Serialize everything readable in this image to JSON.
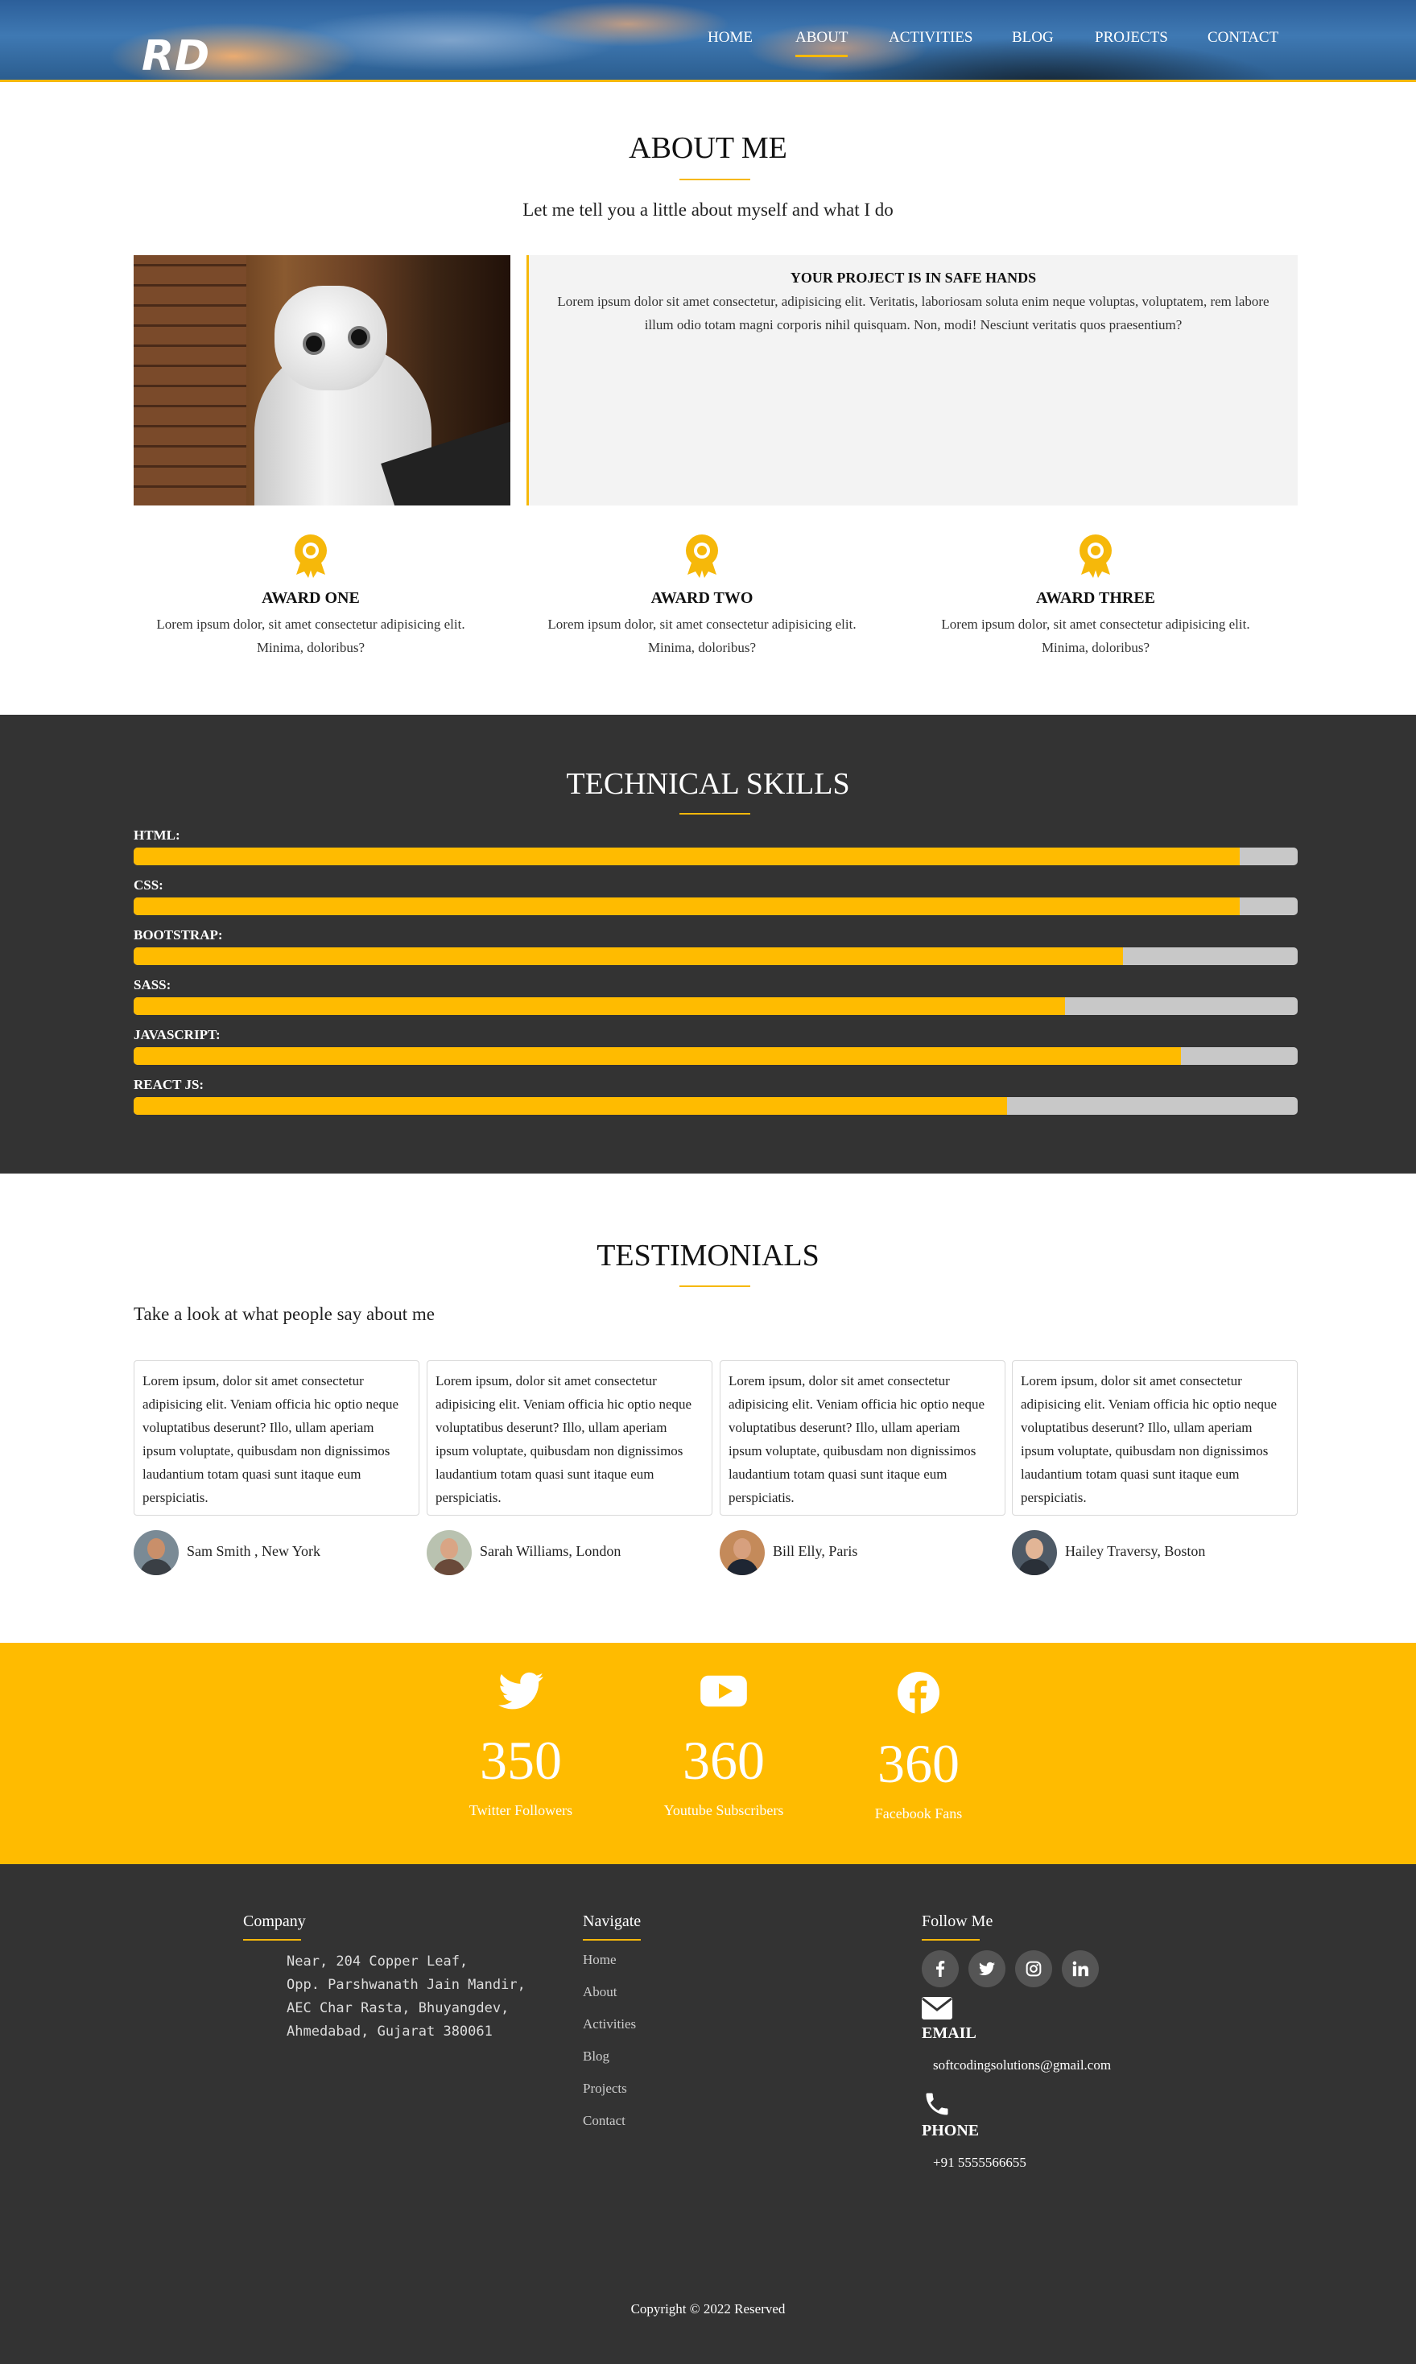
{
  "header": {
    "logo": "RD",
    "nav": [
      {
        "label": "HOME"
      },
      {
        "label": "ABOUT"
      },
      {
        "label": "ACTIVITIES"
      },
      {
        "label": "BLOG"
      },
      {
        "label": "PROJECTS"
      },
      {
        "label": "CONTACT"
      }
    ],
    "active_nav": "ABOUT"
  },
  "about": {
    "title": "ABOUT ME",
    "lead": "Let me tell you a little about myself and what I do",
    "box_title": "YOUR PROJECT IS IN SAFE HANDS",
    "box_text": "Lorem ipsum dolor sit amet consectetur, adipisicing elit. Veritatis, laboriosam soluta enim neque voluptas, voluptatem, rem labore illum odio totam magni corporis nihil quisquam. Non, modi! Nesciunt veritatis quos praesentium?",
    "awards": [
      {
        "title": "AWARD ONE",
        "text": "Lorem ipsum dolor, sit amet consectetur adipisicing elit. Minima, doloribus?"
      },
      {
        "title": "AWARD TWO",
        "text": "Lorem ipsum dolor, sit amet consectetur adipisicing elit. Minima, doloribus?"
      },
      {
        "title": "AWARD THREE",
        "text": "Lorem ipsum dolor, sit amet consectetur adipisicing elit. Minima, doloribus?"
      }
    ]
  },
  "skills": {
    "title": "TECHNICAL SKILLS",
    "items": [
      {
        "label": "HTML:",
        "level": 0.95
      },
      {
        "label": "CSS:",
        "level": 0.95
      },
      {
        "label": "BOOTSTRAP:",
        "level": 0.85
      },
      {
        "label": "SASS:",
        "level": 0.8
      },
      {
        "label": "JAVASCRIPT:",
        "level": 0.9
      },
      {
        "label": "REACT JS:",
        "level": 0.75
      }
    ]
  },
  "testimonials": {
    "title": "TESTIMONIALS",
    "lead": "Take a look at what people say about me",
    "items": [
      {
        "text": "Lorem ipsum, dolor sit amet consectetur adipisicing elit. Veniam officia hic optio neque voluptatibus deserunt? Illo, ullam aperiam ipsum voluptate, quibusdam non dignissimos laudantium totam quasi sunt itaque eum perspiciatis.",
        "author": "Sam Smith , New York"
      },
      {
        "text": "Lorem ipsum, dolor sit amet consectetur adipisicing elit. Veniam officia hic optio neque voluptatibus deserunt? Illo, ullam aperiam ipsum voluptate, quibusdam non dignissimos laudantium totam quasi sunt itaque eum perspiciatis.",
        "author": "Sarah Williams, London"
      },
      {
        "text": "Lorem ipsum, dolor sit amet consectetur adipisicing elit. Veniam officia hic optio neque voluptatibus deserunt? Illo, ullam aperiam ipsum voluptate, quibusdam non dignissimos laudantium totam quasi sunt itaque eum perspiciatis.",
        "author": "Bill Elly, Paris"
      },
      {
        "text": "Lorem ipsum, dolor sit amet consectetur adipisicing elit. Veniam officia hic optio neque voluptatibus deserunt? Illo, ullam aperiam ipsum voluptate, quibusdam non dignissimos laudantium totam quasi sunt itaque eum perspiciatis.",
        "author": "Hailey Traversy, Boston"
      }
    ]
  },
  "stats": [
    {
      "icon": "twitter-icon",
      "value": "350",
      "caption": "Twitter Followers"
    },
    {
      "icon": "youtube-icon",
      "value": "360",
      "caption": "Youtube Subscribers"
    },
    {
      "icon": "facebook-icon",
      "value": "360",
      "caption": "Facebook Fans"
    }
  ],
  "footer": {
    "company": {
      "title": "Company",
      "address": [
        "Near, 204 Copper Leaf,",
        "Opp. Parshwanath Jain Mandir,",
        "AEC Char Rasta, Bhuyangdev,",
        "Ahmedabad, Gujarat 380061"
      ]
    },
    "navigate": {
      "title": "Navigate",
      "links": [
        "Home",
        "About",
        "Activities",
        "Blog",
        "Projects",
        "Contact"
      ]
    },
    "follow": {
      "title": "Follow Me",
      "social_icons": [
        "facebook-icon",
        "twitter-icon",
        "instagram-icon",
        "linkedin-icon"
      ],
      "email_label": "EMAIL",
      "email": "softcodingsolutions@gmail.com",
      "phone_label": "PHONE",
      "phone": "+91 5555566655"
    },
    "copyright": "Copyright © 2022 Reserved"
  },
  "colors": {
    "accent": "#ffbb00",
    "dark": "#333333",
    "skill_track": "#c8c8c8"
  }
}
